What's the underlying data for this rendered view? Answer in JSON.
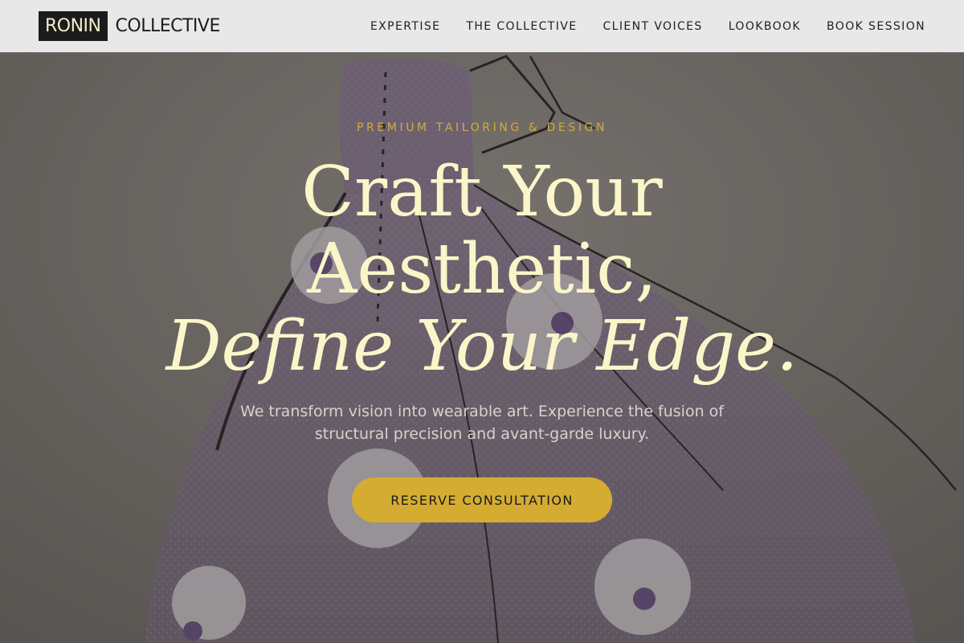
{
  "header": {
    "logo_word1": "RONIN",
    "logo_word2": "COLLECTIVE",
    "nav": [
      {
        "label": "EXPERTISE"
      },
      {
        "label": "THE COLLECTIVE"
      },
      {
        "label": "CLIENT VOICES"
      },
      {
        "label": "LOOKBOOK"
      },
      {
        "label": "BOOK SESSION"
      }
    ]
  },
  "hero": {
    "eyebrow": "PREMIUM TAILORING & DESIGN",
    "headline_line1": "Craft Your",
    "headline_line2": "Aesthetic,",
    "headline_line3": "Define Your Edge.",
    "subcopy": "We transform vision into wearable art. Experience the fusion of structural precision and avant-garde luxury.",
    "cta_label": "RESERVE CONSULTATION",
    "background_image": "gown-sketch-illustration"
  },
  "colors": {
    "accent_gold": "#d4ac32",
    "headline_cream": "#fbf6c9",
    "header_bg": "#e8e8e8",
    "logo_bg": "#1b1b1b"
  }
}
